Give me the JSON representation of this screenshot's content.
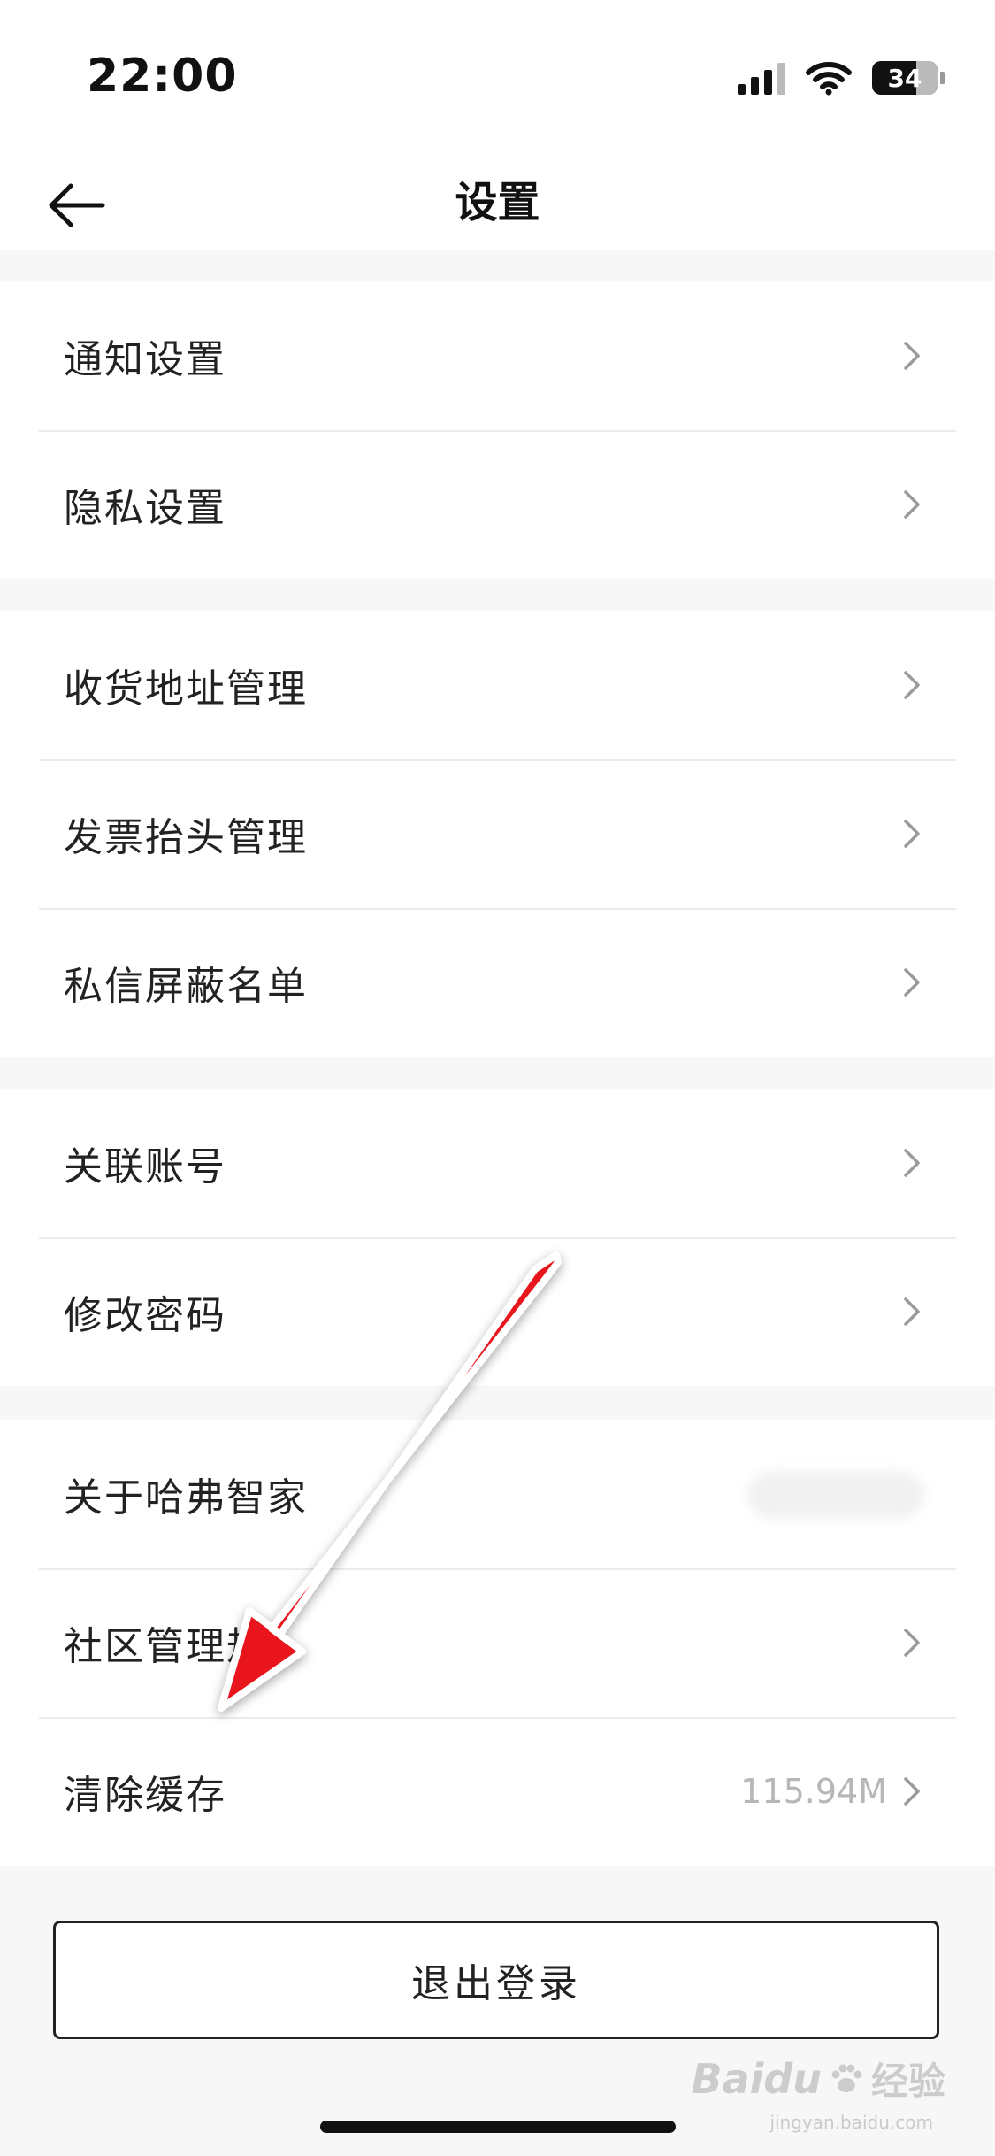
{
  "status_bar": {
    "time": "22:00",
    "battery": "34"
  },
  "nav": {
    "title": "设置"
  },
  "groups": [
    [
      {
        "label": "通知设置"
      },
      {
        "label": "隐私设置"
      }
    ],
    [
      {
        "label": "收货地址管理"
      },
      {
        "label": "发票抬头管理"
      },
      {
        "label": "私信屏蔽名单"
      }
    ],
    [
      {
        "label": "关联账号"
      },
      {
        "label": "修改密码"
      }
    ],
    [
      {
        "label": "关于哈弗智家"
      },
      {
        "label": "社区管理规"
      },
      {
        "label": "清除缓存",
        "value": "115.94M"
      }
    ]
  ],
  "logout": {
    "label": "退出登录"
  },
  "watermark": {
    "brand": "Baidu",
    "suffix": "经验",
    "url": "jingyan.baidu.com"
  },
  "colors": {
    "annotation_arrow": "#e8141c"
  },
  "icons": {
    "back": "arrow-left-icon",
    "chevron": "chevron-right-icon"
  }
}
